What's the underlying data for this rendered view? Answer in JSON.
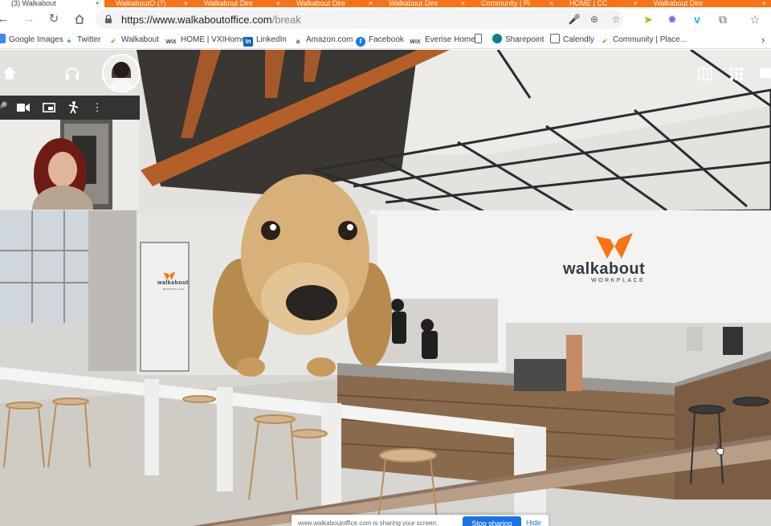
{
  "tabs": [
    {
      "label": "(3) Walkabout",
      "active": true
    },
    {
      "label": "WalkaboutO (?)",
      "active": false
    },
    {
      "label": "Walkabout Dire",
      "active": false
    },
    {
      "label": "Walkabout Dire",
      "active": false
    },
    {
      "label": "Walkabout Dire",
      "active": false
    },
    {
      "label": "Community | Pl",
      "active": false
    },
    {
      "label": "HOME | CC",
      "active": false
    },
    {
      "label": "Walkabout Dire",
      "active": false
    }
  ],
  "address": {
    "url_host": "https://www.walkaboutoffice.com",
    "url_path": "/break"
  },
  "bookmarks": [
    {
      "label": "Google Images",
      "icon": "google-images-icon",
      "color": "#4285f4"
    },
    {
      "label": "Twitter",
      "icon": "twitter-icon",
      "color": "#1da1f2"
    },
    {
      "label": "Walkabout",
      "icon": "walkabout-icon",
      "color": "#f97316"
    },
    {
      "label": "HOME | VXIHome",
      "icon": "wix-icon",
      "color": "#222222"
    },
    {
      "label": "LinkedIn",
      "icon": "linkedin-icon",
      "color": "#0a66c2"
    },
    {
      "label": "Amazon.com",
      "icon": "amazon-icon",
      "color": "#222222"
    },
    {
      "label": "Facebook",
      "icon": "facebook-icon",
      "color": "#1877f2"
    },
    {
      "label": "Everise Home",
      "icon": "wix-icon",
      "color": "#222222"
    },
    {
      "label": "",
      "icon": "document-icon",
      "color": "#5f6368"
    },
    {
      "label": "Sharepoint",
      "icon": "sharepoint-icon",
      "color": "#038387"
    },
    {
      "label": "Calendly",
      "icon": "calendly-icon",
      "color": "#5f6368"
    },
    {
      "label": "Community | Place...",
      "icon": "walkabout-icon",
      "color": "#f97316"
    }
  ],
  "office": {
    "logo_word": "walkabout",
    "logo_sub": "WORKPLACE",
    "small_logo_word": "walkabout",
    "small_logo_sub": "WORKPLACE"
  },
  "share_bar": {
    "message": "www.walkaboutoffice.com is sharing your screen.",
    "stop_label": "Stop sharing",
    "hide_label": "Hide"
  },
  "colors": {
    "brand_orange": "#f97316",
    "link_blue": "#1a73e8"
  }
}
